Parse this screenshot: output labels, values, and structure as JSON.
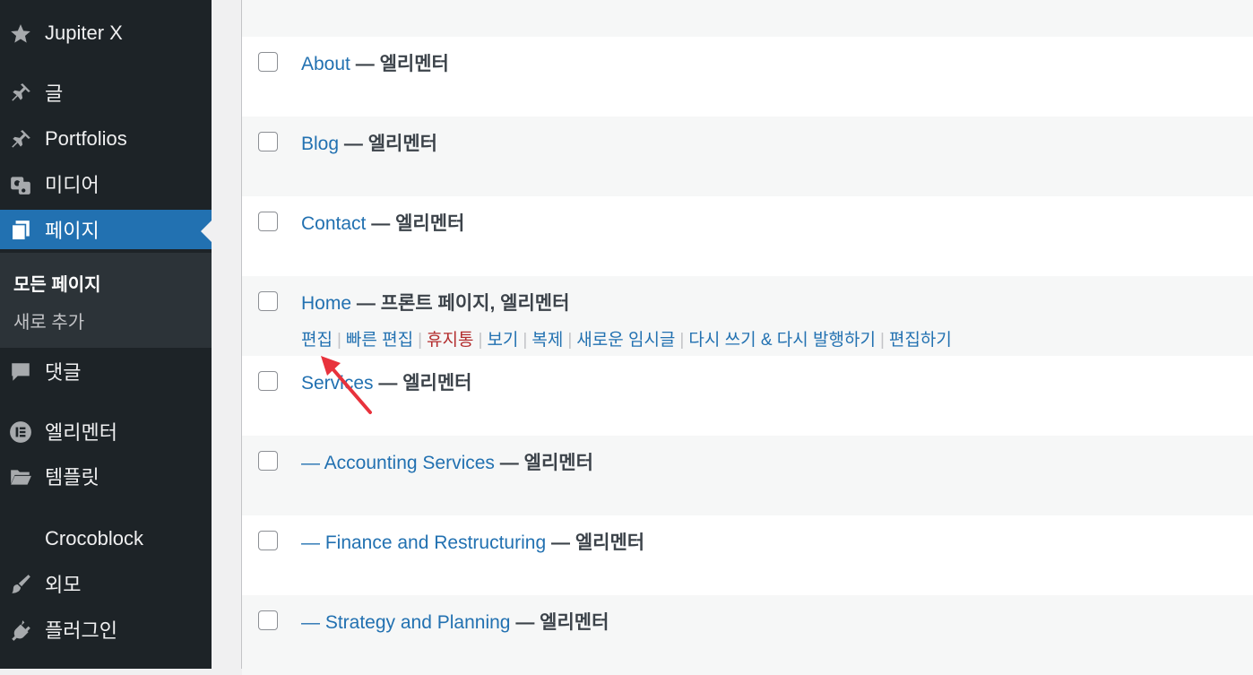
{
  "sidebar": {
    "items": [
      {
        "label": "Jupiter X",
        "icon": "star-icon"
      },
      {
        "label": "글",
        "icon": "pin-icon"
      },
      {
        "label": "Portfolios",
        "icon": "pin-icon"
      },
      {
        "label": "미디어",
        "icon": "media-icon"
      },
      {
        "label": "페이지",
        "icon": "pages-icon",
        "active": true
      },
      {
        "label": "댓글",
        "icon": "comment-icon"
      },
      {
        "label": "엘리멘터",
        "icon": "elementor-icon"
      },
      {
        "label": "템플릿",
        "icon": "folder-icon"
      },
      {
        "label": "Crocoblock",
        "icon": "crocoblock-icon"
      },
      {
        "label": "외모",
        "icon": "brush-icon"
      },
      {
        "label": "플러그인",
        "icon": "plugin-icon"
      }
    ],
    "submenu": [
      {
        "label": "모든 페이지",
        "current": true
      },
      {
        "label": "새로 추가"
      }
    ]
  },
  "pages": [
    {
      "title": "About",
      "state": "엘리멘터"
    },
    {
      "title": "Blog",
      "state": "엘리멘터"
    },
    {
      "title": "Contact",
      "state": "엘리멘터"
    },
    {
      "title": "Home",
      "state": "프론트 페이지, 엘리멘터"
    },
    {
      "title": "Services",
      "state": "엘리멘터"
    },
    {
      "title": "— Accounting Services",
      "state": "엘리멘터"
    },
    {
      "title": "— Finance and Restructuring",
      "state": "엘리멘터"
    },
    {
      "title": "— Strategy and Planning",
      "state": "엘리멘터"
    }
  ],
  "title_separator": "—",
  "row_actions": [
    "편집",
    "빠른 편집",
    "휴지통",
    "보기",
    "복제",
    "새로운 임시글",
    "다시 쓰기 & 다시 발행하기",
    "편집하기"
  ],
  "colors": {
    "accent": "#2271b1",
    "sidebar_bg": "#1d2327",
    "trash": "#b32d2e",
    "annotation_arrow": "#e8323c"
  }
}
